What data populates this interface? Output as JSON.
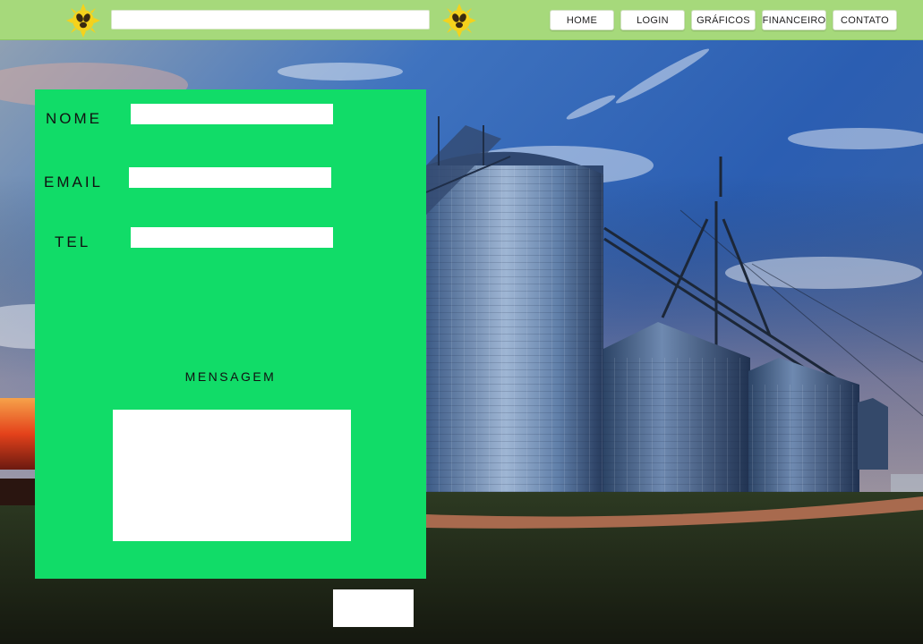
{
  "header": {
    "search": {
      "value": "",
      "placeholder": ""
    },
    "nav": [
      {
        "label": "HOME"
      },
      {
        "label": "LOGIN"
      },
      {
        "label": "GRÁFICOS"
      },
      {
        "label": "FINANCEIRO"
      },
      {
        "label": "CONTATO"
      }
    ],
    "logo_icon": "coffee-bean-sun-icon"
  },
  "form": {
    "fields": [
      {
        "label": "NOME",
        "value": ""
      },
      {
        "label": "EMAIL",
        "value": ""
      },
      {
        "label": "TEL",
        "value": ""
      }
    ],
    "message": {
      "label": "MENSAGEM",
      "value": ""
    },
    "submit_label": ""
  },
  "colors": {
    "topbar": "#a6d97b",
    "panel": "#11dc68",
    "logo_sun": "#f5d21c"
  }
}
